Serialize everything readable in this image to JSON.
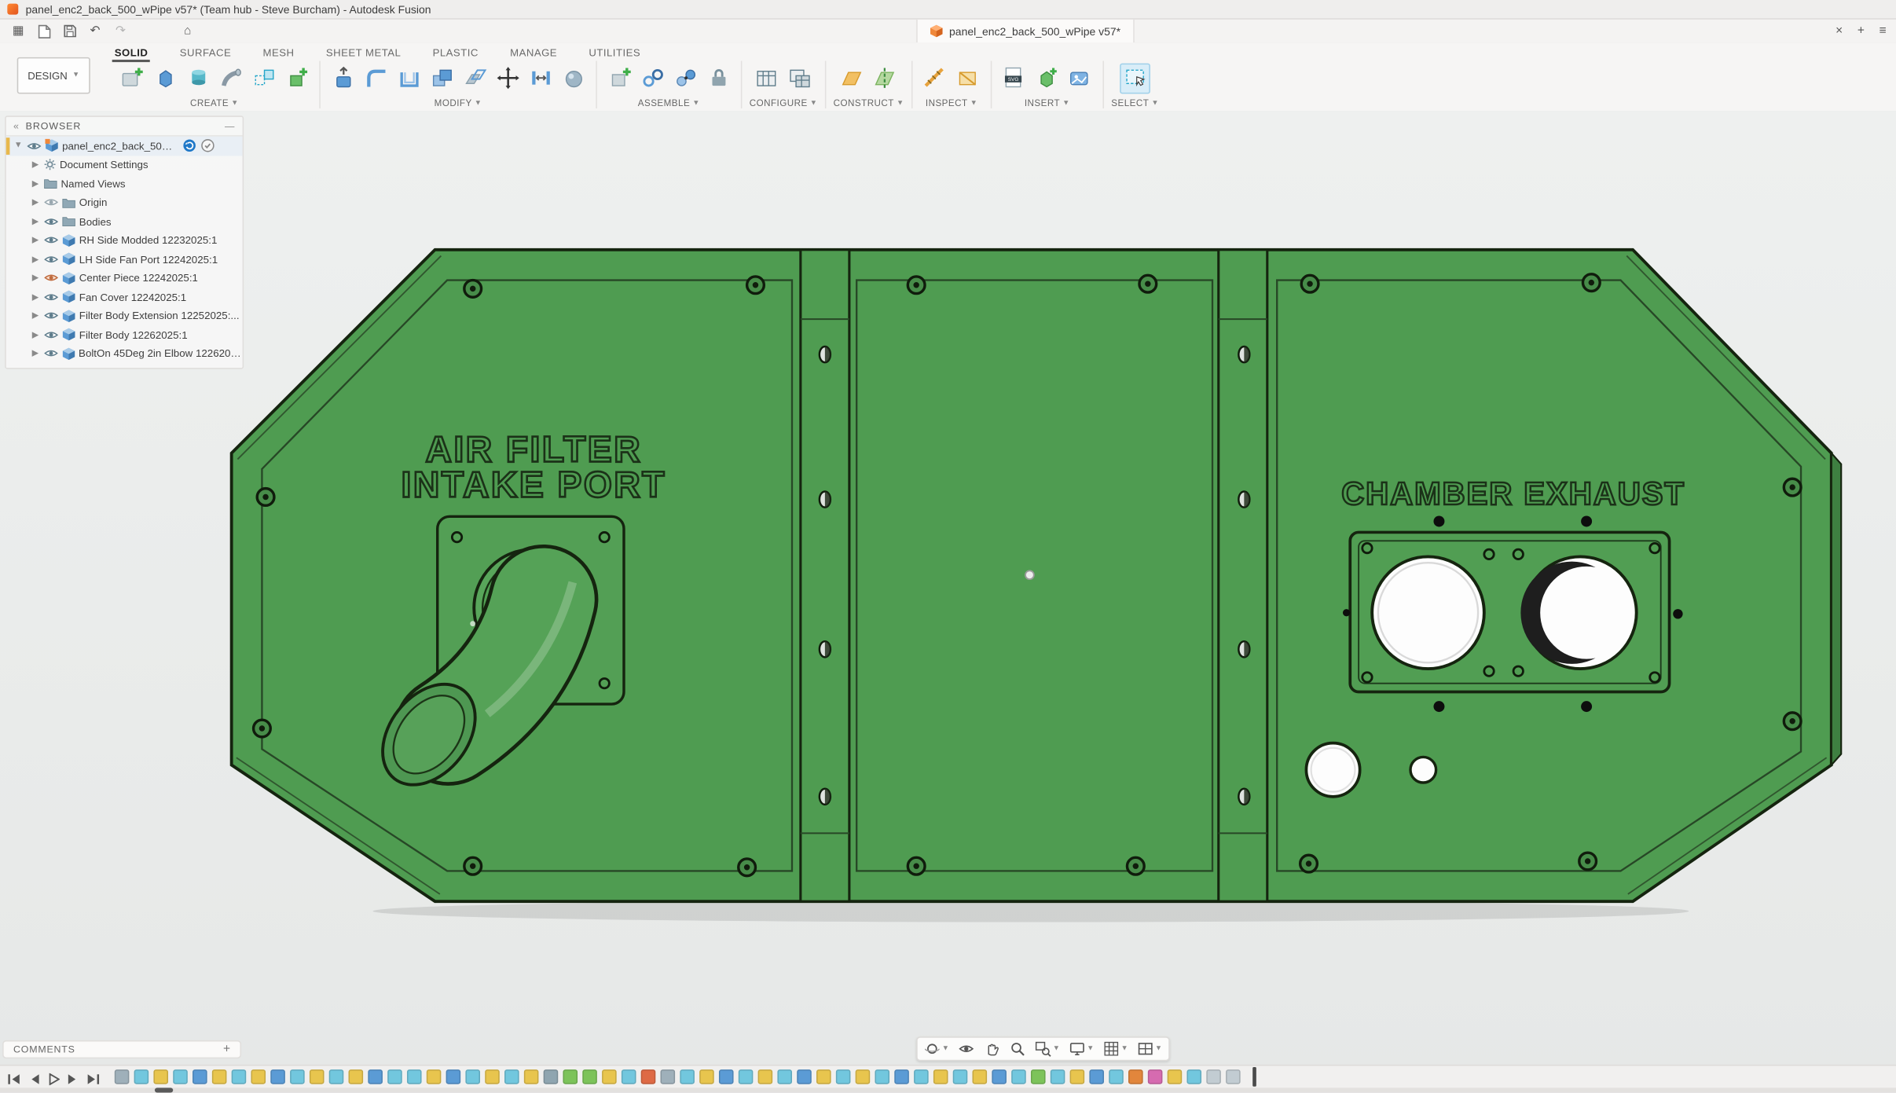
{
  "titlebar": {
    "title": "panel_enc2_back_500_wPipe v57* (Team hub - Steve Burcham) - Autodesk Fusion"
  },
  "tabbar": {
    "document_tab": "panel_enc2_back_500_wPipe v57*"
  },
  "ribbon": {
    "design_button": "DESIGN",
    "tabs": [
      {
        "label": "SOLID",
        "active": true
      },
      {
        "label": "SURFACE",
        "active": false
      },
      {
        "label": "MESH",
        "active": false
      },
      {
        "label": "SHEET METAL",
        "active": false
      },
      {
        "label": "PLASTIC",
        "active": false
      },
      {
        "label": "MANAGE",
        "active": false
      },
      {
        "label": "UTILITIES",
        "active": false
      }
    ],
    "groups": [
      {
        "label": "CREATE"
      },
      {
        "label": "MODIFY"
      },
      {
        "label": "ASSEMBLE"
      },
      {
        "label": "CONFIGURE"
      },
      {
        "label": "CONSTRUCT"
      },
      {
        "label": "INSPECT"
      },
      {
        "label": "INSERT"
      },
      {
        "label": "SELECT"
      }
    ],
    "insert_svg_badge": "SVG"
  },
  "browser": {
    "header": "BROWSER",
    "root_label": "panel_enc2_back_500_v...",
    "items": [
      {
        "label": "Document Settings"
      },
      {
        "label": "Named Views"
      },
      {
        "label": "Origin"
      },
      {
        "label": "Bodies"
      },
      {
        "label": "RH Side Modded 12232025:1"
      },
      {
        "label": "LH Side Fan Port 12242025:1"
      },
      {
        "label": "Center Piece 12242025:1"
      },
      {
        "label": "Fan Cover 12242025:1"
      },
      {
        "label": "Filter Body Extension 12252025:..."
      },
      {
        "label": "Filter Body 12262025:1"
      },
      {
        "label": "BoltOn 45Deg 2in Elbow 1226202..."
      }
    ]
  },
  "canvas": {
    "engravings": {
      "air_filter_line1": "AIR FILTER",
      "air_filter_line2": "INTAKE PORT",
      "chamber_exhaust": "CHAMBER EXHAUST"
    },
    "colors": {
      "panel_green": "#4f9c51",
      "panel_green_dark": "#3e7f41",
      "edge_outline": "#15240f",
      "background": "#ebedec"
    }
  },
  "comments": {
    "label": "COMMENTS"
  },
  "timeline": {
    "features": [
      "#9fb0ba",
      "#72c7de",
      "#e8c54e",
      "#72c7de",
      "#5b9bd5",
      "#e8c54e",
      "#72c7de",
      "#e8c54e",
      "#5b9bd5",
      "#72c7de",
      "#e8c54e",
      "#72c7de",
      "#e8c54e",
      "#5b9bd5",
      "#72c7de",
      "#72c7de",
      "#e8c54e",
      "#5b9bd5",
      "#72c7de",
      "#e8c54e",
      "#72c7de",
      "#e8c54e",
      "#8fa5b0",
      "#7dc35a",
      "#7dc35a",
      "#e8c54e",
      "#72c7de",
      "#de6a45",
      "#9fb0ba",
      "#72c7de",
      "#e8c54e",
      "#5b9bd5",
      "#72c7de",
      "#e8c54e",
      "#72c7de",
      "#5b9bd5",
      "#e8c54e",
      "#72c7de",
      "#e8c54e",
      "#72c7de",
      "#5b9bd5",
      "#72c7de",
      "#e8c54e",
      "#72c7de",
      "#e8c54e",
      "#5b9bd5",
      "#72c7de",
      "#7dc35a",
      "#72c7de",
      "#e8c54e",
      "#5b9bd5",
      "#72c7de",
      "#e2863c",
      "#d66bb0",
      "#e8c54e",
      "#72c7de",
      "#c2ccd2",
      "#c2ccd2"
    ]
  }
}
